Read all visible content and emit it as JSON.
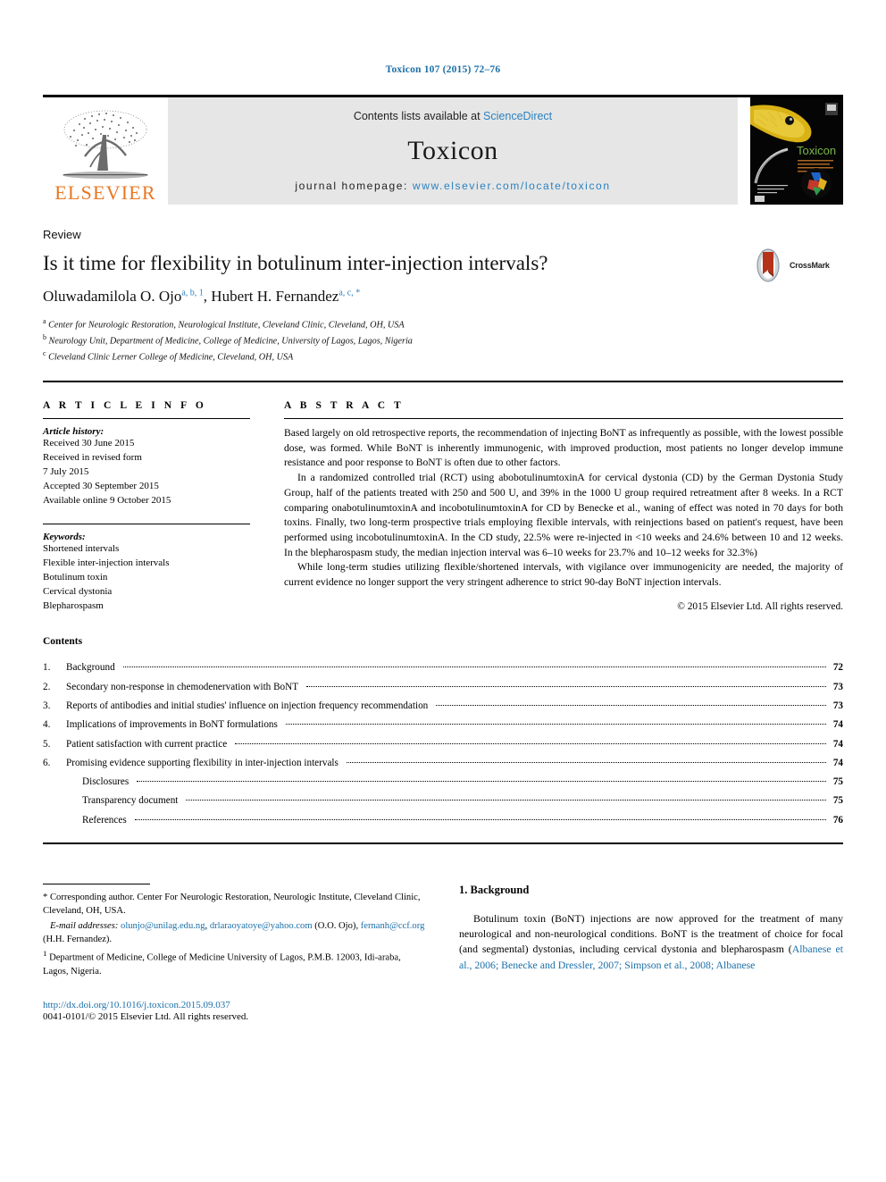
{
  "running_head": "Toxicon 107 (2015) 72–76",
  "banner": {
    "publisher": "ELSEVIER",
    "contents_prefix": "Contents lists available at ",
    "contents_link": "ScienceDirect",
    "journal_name": "Toxicon",
    "homepage_prefix": "journal homepage: ",
    "homepage_url": "www.elsevier.com/locate/toxicon",
    "cover_title": "Toxicon",
    "link_color": "#2b82c0",
    "elsevier_orange": "#E87722"
  },
  "article": {
    "type": "Review",
    "title": "Is it time for flexibility in botulinum inter-injection intervals?",
    "authors": [
      {
        "name": "Oluwadamilola O. Ojo",
        "marks": "a, b, 1"
      },
      {
        "name": "Hubert H. Fernandez",
        "marks": "a, c, *"
      }
    ],
    "authors_separator": ", ",
    "affiliations": [
      {
        "mark": "a",
        "text": "Center for Neurologic Restoration, Neurological Institute, Cleveland Clinic, Cleveland, OH, USA"
      },
      {
        "mark": "b",
        "text": "Neurology Unit, Department of Medicine, College of Medicine, University of Lagos, Lagos, Nigeria"
      },
      {
        "mark": "c",
        "text": "Cleveland Clinic Lerner College of Medicine, Cleveland, OH, USA"
      }
    ],
    "crossmark_label": "CrossMark"
  },
  "info": {
    "heading": "A R T I C L E  I N F O",
    "history_label": "Article history:",
    "history": [
      "Received 30 June 2015",
      "Received in revised form",
      "7 July 2015",
      "Accepted 30 September 2015",
      "Available online 9 October 2015"
    ],
    "keywords_label": "Keywords:",
    "keywords": [
      "Shortened intervals",
      "Flexible inter-injection intervals",
      "Botulinum toxin",
      "Cervical dystonia",
      "Blepharospasm"
    ]
  },
  "abstract": {
    "heading": "A B S T R A C T",
    "paragraphs": [
      "Based largely on old retrospective reports, the recommendation of injecting BoNT as infrequently as possible, with the lowest possible dose, was formed. While BoNT is inherently immunogenic, with improved production, most patients no longer develop immune resistance and poor response to BoNT is often due to other factors.",
      "In a randomized controlled trial (RCT) using abobotulinumtoxinA for cervical dystonia (CD) by the German Dystonia Study Group, half of the patients treated with 250 and 500 U, and 39% in the 1000 U group required retreatment after 8 weeks. In a RCT comparing onabotulinumtoxinA and incobotulinumtoxinA for CD by Benecke et al., waning of effect was noted in 70 days for both toxins. Finally, two long-term prospective trials employing flexible intervals, with reinjections based on patient's request, have been performed using incobotulinumtoxinA. In the CD study, 22.5% were re-injected in <10 weeks and 24.6% between 10 and 12 weeks. In the blepharospasm study, the median injection interval was 6–10 weeks for 23.7% and 10–12 weeks for 32.3%)",
      "While long-term studies utilizing flexible/shortened intervals, with vigilance over immunogenicity are needed, the majority of current evidence no longer support the very stringent adherence to strict 90-day BoNT injection intervals."
    ],
    "copyright": "© 2015 Elsevier Ltd. All rights reserved."
  },
  "contents": {
    "heading": "Contents",
    "items": [
      {
        "num": "1.",
        "label": "Background",
        "page": "72",
        "sub": false
      },
      {
        "num": "2.",
        "label": "Secondary non-response in chemodenervation with BoNT",
        "page": "73",
        "sub": false
      },
      {
        "num": "3.",
        "label": "Reports of antibodies and initial studies' influence on injection frequency recommendation",
        "page": "73",
        "sub": false
      },
      {
        "num": "4.",
        "label": "Implications of improvements in BoNT formulations",
        "page": "74",
        "sub": false
      },
      {
        "num": "5.",
        "label": "Patient satisfaction with current practice",
        "page": "74",
        "sub": false
      },
      {
        "num": "6.",
        "label": "Promising evidence supporting flexibility in inter-injection intervals",
        "page": "74",
        "sub": false
      },
      {
        "num": "",
        "label": "Disclosures",
        "page": "75",
        "sub": true
      },
      {
        "num": "",
        "label": "Transparency document",
        "page": "75",
        "sub": true
      },
      {
        "num": "",
        "label": "References",
        "page": "76",
        "sub": true
      }
    ]
  },
  "footnotes": {
    "corresponding_marker": "*",
    "corresponding": "Corresponding author. Center For Neurologic Restoration, Neurologic Institute, Cleveland Clinic, Cleveland, OH, USA.",
    "email_label": "E-mail addresses:",
    "emails": [
      {
        "address": "olunjo@unilag.edu.ng",
        "owner": ""
      },
      {
        "address": "drlaraoyatoye@yahoo.com",
        "owner": "(O.O. Ojo)"
      },
      {
        "address": "fernanh@ccf.org",
        "owner": "(H.H. Fernandez)."
      }
    ],
    "note_marker": "1",
    "note": "Department of Medicine, College of Medicine University of Lagos, P.M.B. 12003, Idi-araba, Lagos, Nigeria.",
    "doi": "http://dx.doi.org/10.1016/j.toxicon.2015.09.037",
    "issn": "0041-0101/© 2015 Elsevier Ltd. All rights reserved."
  },
  "body": {
    "section_heading": "1.  Background",
    "paragraph_lead": "Botulinum toxin (BoNT) injections are now approved for the treatment of many neurological and non-neurological conditions. BoNT is the treatment of choice for focal (and segmental) dystonias, including cervical dystonia and blepharospasm (",
    "paragraph_citation": "Albanese et al., 2006; Benecke and Dressler, 2007; Simpson et al., 2008; Albanese"
  }
}
